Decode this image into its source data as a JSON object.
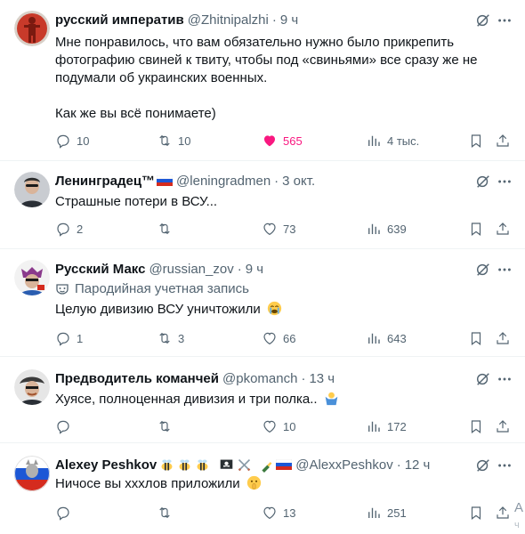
{
  "tweets": [
    {
      "name": "русский императив",
      "handle": "@Zhitnipalzhi",
      "sep": "·",
      "time": "9 ч",
      "text": [
        "Мне понравилось, что вам обязательно нужно было прикрепить",
        "фотографию свиней к твиту, чтобы под «свиньями» все сразу же не",
        "подумали об украинских военных.",
        "",
        "Как же вы всё понимаете)"
      ],
      "replies": "10",
      "retweets": "10",
      "likes": "565",
      "views": "4 тыс.",
      "liked": true
    },
    {
      "name": "Ленинградец™",
      "handle": "@leningradmen",
      "sep": "·",
      "time": "3 окт.",
      "text": [
        "Страшные потери в ВСУ..."
      ],
      "replies": "2",
      "retweets": "",
      "likes": "73",
      "views": "639"
    },
    {
      "name": "Русский Макс",
      "handle": "@russian_zov",
      "sep": "·",
      "time": "9 ч",
      "parody": "Пародийная учетная запись",
      "text": [
        "Целую дивизию ВСУ уничтожили"
      ],
      "replies": "1",
      "retweets": "3",
      "likes": "66",
      "views": "643"
    },
    {
      "name": "Предводитель команчей",
      "handle": "@pkomanch",
      "sep": "·",
      "time": "13 ч",
      "text": [
        "Хуясе, полноценная дивизия и три полка.."
      ],
      "replies": "",
      "retweets": "",
      "likes": "10",
      "views": "172"
    },
    {
      "name": "Alexey Peshkov",
      "handle": "@AlexxPeshkov",
      "sep": "·",
      "time": "12 ч",
      "text": [
        "Ничосе вы хххлов приложили"
      ],
      "replies": "",
      "retweets": "",
      "likes": "13",
      "views": "251"
    }
  ],
  "edge_text": {
    "letter": "А",
    "sub": "ч"
  },
  "icons": {
    "reply": "reply-icon",
    "retweet": "retweet-icon",
    "like": "heart-icon",
    "views": "views-icon",
    "bookmark": "bookmark-icon",
    "share": "share-icon",
    "grok": "grok-icon",
    "more": "more-icon"
  },
  "colors": {
    "text": "#0f1419",
    "secondary": "#536471",
    "like": "#f91880",
    "divider": "#eff3f4"
  }
}
